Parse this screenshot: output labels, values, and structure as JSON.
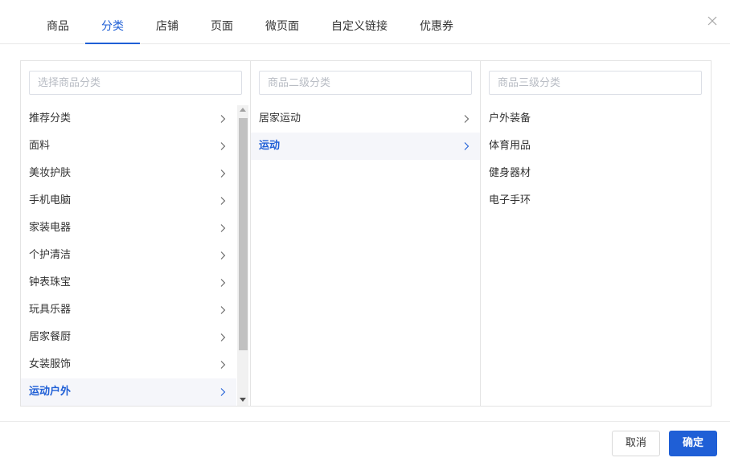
{
  "tabs": [
    {
      "label": "商品"
    },
    {
      "label": "分类",
      "active": true
    },
    {
      "label": "店铺"
    },
    {
      "label": "页面"
    },
    {
      "label": "微页面"
    },
    {
      "label": "自定义链接"
    },
    {
      "label": "优惠券"
    }
  ],
  "level1": {
    "placeholder": "选择商品分类",
    "items": [
      {
        "label": "推荐分类"
      },
      {
        "label": "面料"
      },
      {
        "label": "美妆护肤"
      },
      {
        "label": "手机电脑"
      },
      {
        "label": "家装电器"
      },
      {
        "label": "个护清洁"
      },
      {
        "label": "钟表珠宝"
      },
      {
        "label": "玩具乐器"
      },
      {
        "label": "居家餐厨"
      },
      {
        "label": "女装服饰"
      },
      {
        "label": "运动户外",
        "active": true
      }
    ]
  },
  "level2": {
    "placeholder": "商品二级分类",
    "items": [
      {
        "label": "居家运动"
      },
      {
        "label": "运动",
        "active": true
      }
    ]
  },
  "level3": {
    "placeholder": "商品三级分类",
    "items": [
      {
        "label": "户外装备"
      },
      {
        "label": "体育用品"
      },
      {
        "label": "健身器材"
      },
      {
        "label": "电子手环"
      }
    ]
  },
  "footer": {
    "cancel_label": "取消",
    "ok_label": "确定"
  },
  "colors": {
    "accent": "#1f5fd6",
    "active_bg": "#f5f6fa"
  }
}
